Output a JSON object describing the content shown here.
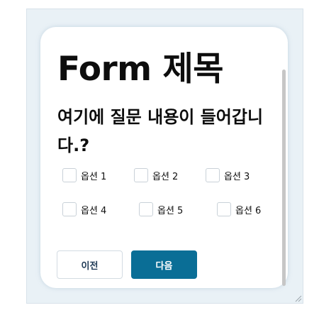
{
  "form": {
    "title": "Form 제목",
    "question": "여기에 질문 내용이 들어갑니다.?",
    "options": [
      {
        "label": "옵션 1",
        "checked": false
      },
      {
        "label": "옵션 2",
        "checked": false
      },
      {
        "label": "옵션 3",
        "checked": false
      },
      {
        "label": "옵션 4",
        "checked": false
      },
      {
        "label": "옵션 5",
        "checked": false
      },
      {
        "label": "옵션 6",
        "checked": false
      }
    ]
  },
  "buttons": {
    "prev_label": "이전",
    "next_label": "다음"
  },
  "colors": {
    "accent": "#0a6e96",
    "background": "#e9f1f6",
    "card": "#ffffff"
  }
}
